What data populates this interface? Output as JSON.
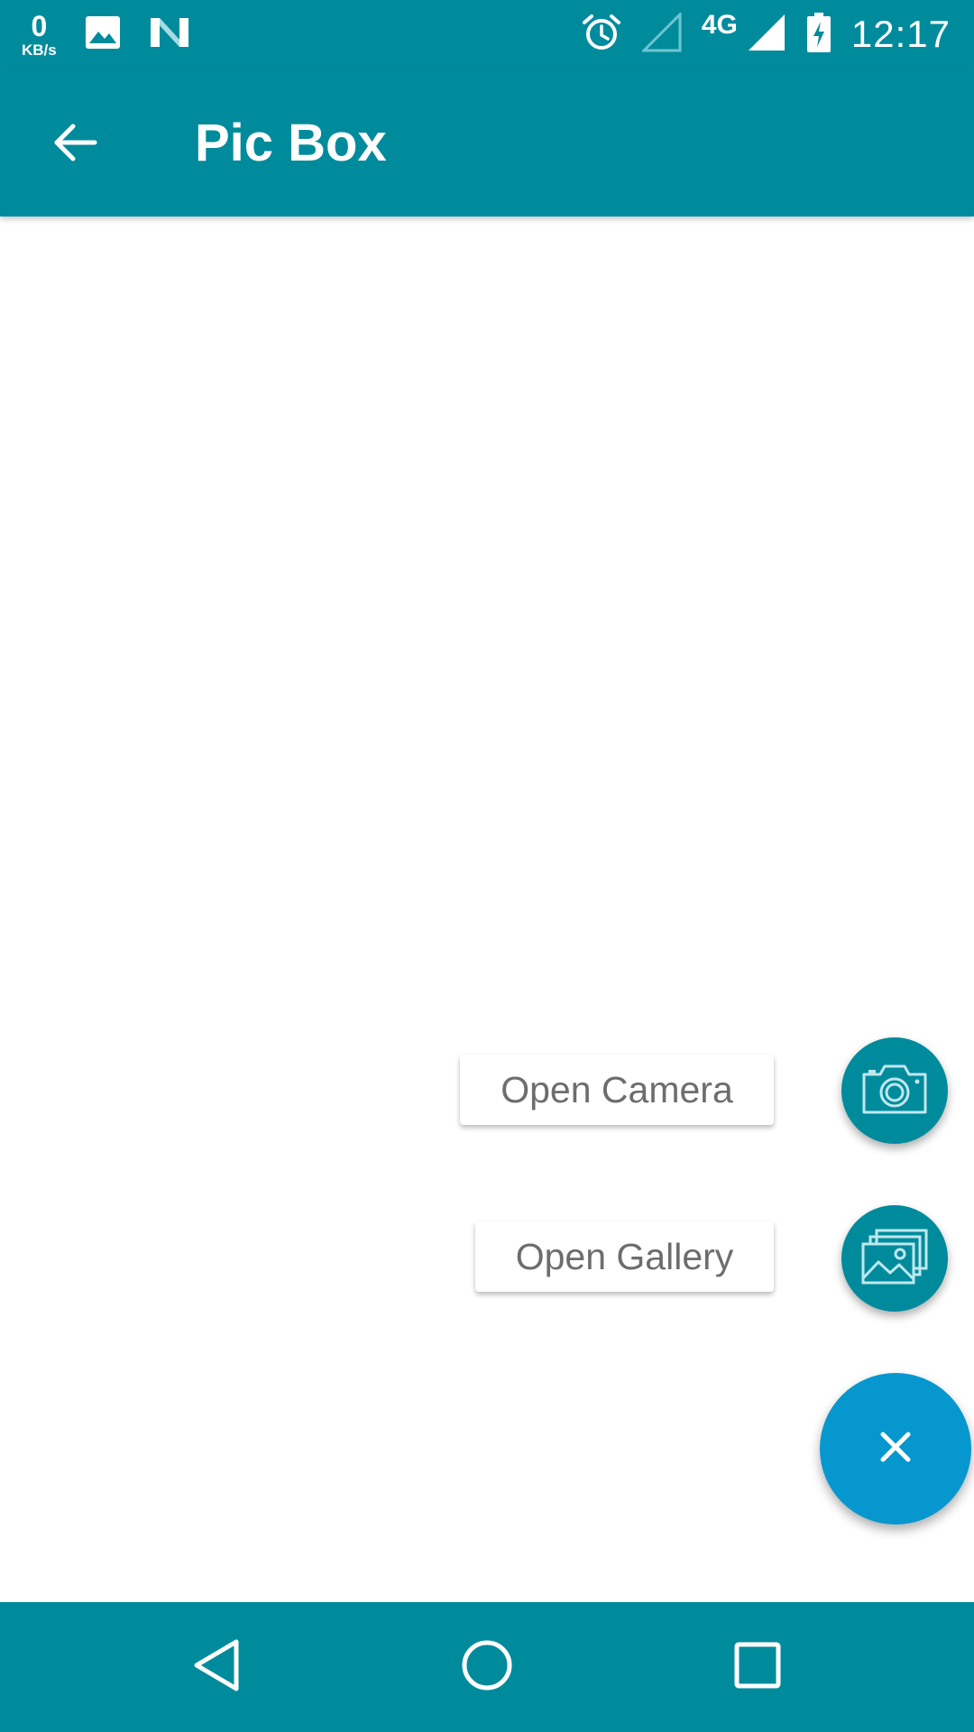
{
  "status_bar": {
    "speed_value": "0",
    "speed_unit": "KB/s",
    "network_type": "4G",
    "time": "12:17",
    "icons": [
      "image-notification-icon",
      "n-notification-icon",
      "alarm-icon",
      "signal-empty-icon",
      "signal-full-icon",
      "battery-charging-icon"
    ]
  },
  "app_bar": {
    "title": "Pic Box",
    "back_icon": "arrow-back-icon"
  },
  "fab_menu": {
    "camera_label": "Open Camera",
    "camera_icon": "camera-icon",
    "gallery_label": "Open Gallery",
    "gallery_icon": "gallery-icon",
    "close_icon": "close-icon"
  },
  "nav_bar": {
    "icons": [
      "nav-back-icon",
      "nav-home-icon",
      "nav-recents-icon"
    ]
  },
  "colors": {
    "primary": "#008b9c",
    "accent": "#0797cf",
    "background": "#ffffff",
    "label_text": "#6d6d6d"
  }
}
